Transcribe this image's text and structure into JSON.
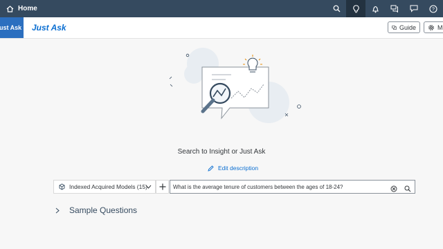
{
  "shell": {
    "home_label": "Home",
    "icons": [
      "search-icon",
      "lightbulb-icon",
      "bell-icon",
      "discussion-icon",
      "feedback-icon",
      "help-icon"
    ]
  },
  "titlebar": {
    "app_tab_label": "Just Ask",
    "page_title": "Just Ask",
    "guide_label": "Guide",
    "manage_label": "M"
  },
  "main": {
    "caption": "Search to Insight or Just Ask",
    "edit_description": "Edit description"
  },
  "search": {
    "model_label": "Indexed Acquired Models (15)",
    "query_value": "What is the average tenure of customers between the ages of 18-24?"
  },
  "sample_questions": {
    "label": "Sample Questions"
  },
  "colors": {
    "shell": "#354a5f",
    "accent": "#0a6ed1",
    "app_tab": "#2c6fbf"
  }
}
